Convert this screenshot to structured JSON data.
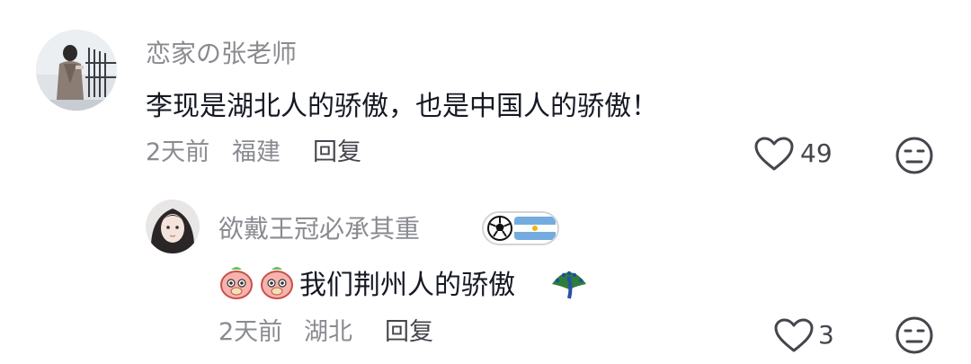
{
  "comments": [
    {
      "username": "恋家の张老师",
      "content": "李现是湖北人的骄傲，也是中国人的骄傲！",
      "time": "2天前",
      "location": "福建",
      "reply_label": "回复",
      "likes": "49"
    }
  ],
  "reply": {
    "username": "欲戴王冠必承其重",
    "badge": "soccer-argentina-flag",
    "leading_emojis": [
      "peach-face-emoji",
      "peach-face-emoji"
    ],
    "content": "我们荆州人的骄傲",
    "trailing_emoji": "peacock-emoji",
    "time": "2天前",
    "location": "湖北",
    "reply_label": "回复",
    "likes": "3"
  }
}
